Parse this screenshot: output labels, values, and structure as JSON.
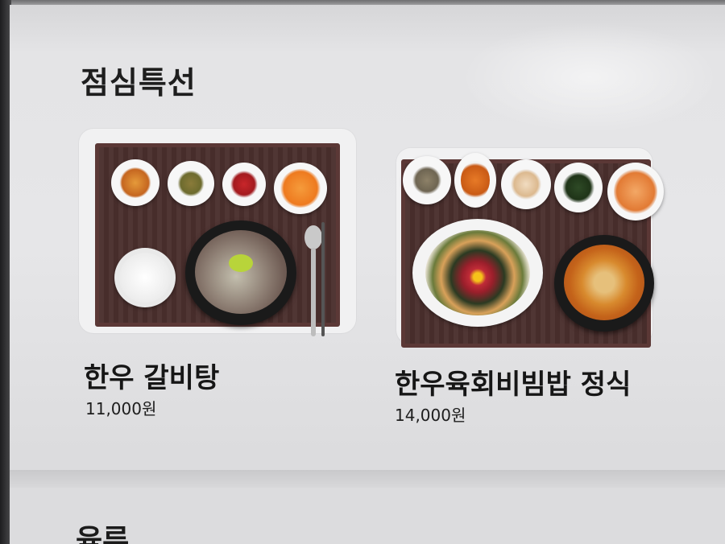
{
  "section": {
    "title": "점심특선"
  },
  "menu_items": [
    {
      "name": "한우 갈비탕",
      "price": "11,000원"
    },
    {
      "name": "한우육회비빔밥 정식",
      "price": "14,000원"
    }
  ],
  "next_section": {
    "title": "육류"
  },
  "colors": {
    "tray": "#4a2f2d",
    "background": "#e4e4e6",
    "text": "#1e1e1e"
  }
}
